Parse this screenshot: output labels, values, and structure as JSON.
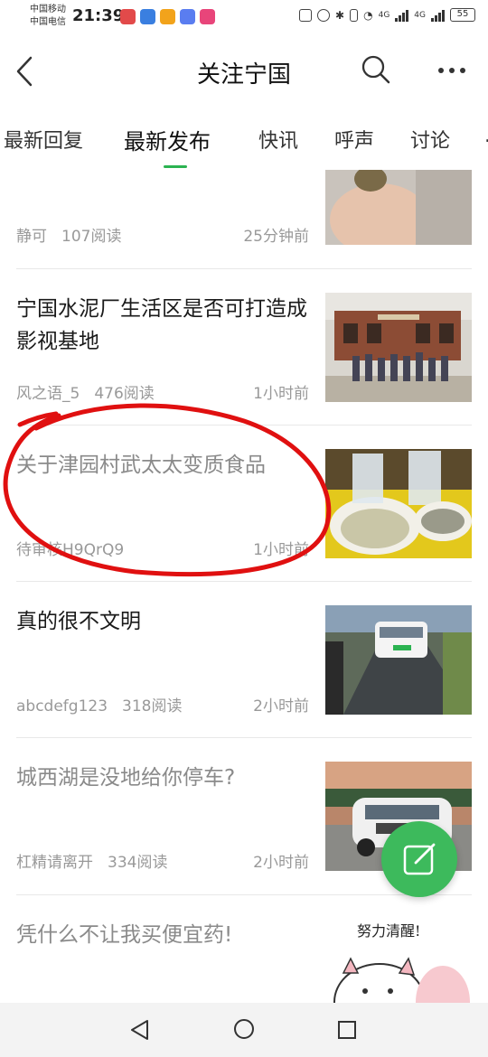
{
  "status_bar": {
    "carrier_1": "中国移动",
    "carrier_2": "中国电信",
    "time": "21:39",
    "net_1": "4G",
    "net_2": "4G",
    "battery": "55"
  },
  "header": {
    "title": "关注宁国"
  },
  "tabs": [
    {
      "label": "最新回复",
      "active": false
    },
    {
      "label": "最新发布",
      "active": true
    },
    {
      "label": "快讯",
      "active": false
    },
    {
      "label": "呼声",
      "active": false
    },
    {
      "label": "讨论",
      "active": false
    }
  ],
  "feed": [
    {
      "headline": "",
      "author": "静可",
      "reads": "107阅读",
      "time": "25分钟前",
      "read": false
    },
    {
      "headline": "宁国水泥厂生活区是否可打造成影视基地",
      "author": "风之语_5",
      "reads": "476阅读",
      "time": "1小时前",
      "read": false
    },
    {
      "headline": "关于津园村武太太变质食品",
      "author": "待审核H9QrQ9",
      "reads": "",
      "time": "1小时前",
      "read": true
    },
    {
      "headline": "真的很不文明",
      "author": "abcdefg123",
      "reads": "318阅读",
      "time": "2小时前",
      "read": false
    },
    {
      "headline": "城西湖是没地给你停车?",
      "author": "杠精请离开",
      "reads": "334阅读",
      "time": "2小时前",
      "read": true
    },
    {
      "headline": "凭什么不让我买便宜药!",
      "author": "",
      "reads": "",
      "time": "",
      "read": true
    }
  ],
  "sticker_text": "努力清醒!",
  "colors": {
    "accent": "#2bb351",
    "fab": "#3dba5c",
    "annotation": "#e01010"
  }
}
